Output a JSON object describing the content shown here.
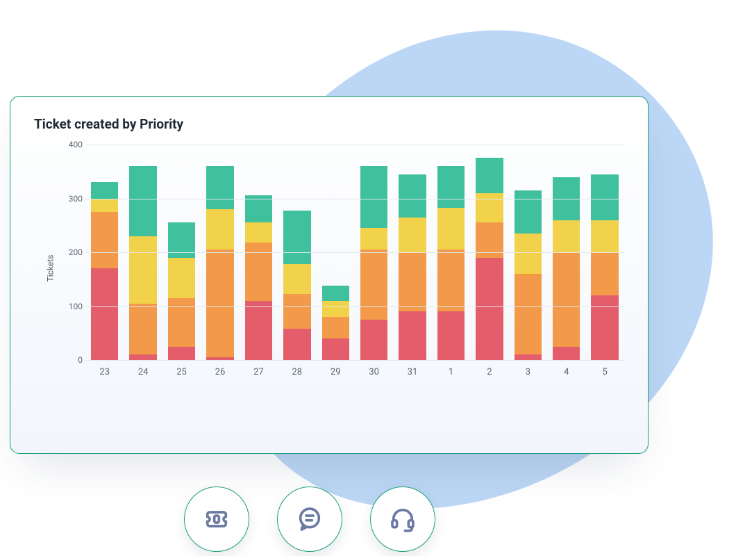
{
  "title": "Ticket created by Priority",
  "colors": {
    "red": "#e35d6a",
    "orange": "#f2994a",
    "yellow": "#f2d24a",
    "green": "#3fc19e",
    "card_border": "#1e9e7a",
    "blob": "#bcd6f5"
  },
  "chart_data": {
    "type": "bar",
    "stacked": true,
    "title": "Ticket created by Priority",
    "xlabel": "",
    "ylabel": "Tickets",
    "ylim": [
      0,
      400
    ],
    "yticks": [
      0,
      100,
      200,
      300,
      400
    ],
    "categories": [
      "23",
      "24",
      "25",
      "26",
      "27",
      "28",
      "29",
      "30",
      "31",
      "1",
      "2",
      "3",
      "4",
      "5"
    ],
    "series": [
      {
        "name": "red",
        "color": "#e35d6a",
        "values": [
          170,
          10,
          25,
          5,
          110,
          58,
          40,
          75,
          90,
          90,
          190,
          10,
          25,
          120
        ]
      },
      {
        "name": "orange",
        "color": "#f2994a",
        "values": [
          105,
          95,
          90,
          200,
          108,
          65,
          40,
          130,
          110,
          115,
          65,
          150,
          175,
          80
        ]
      },
      {
        "name": "yellow",
        "color": "#f2d24a",
        "values": [
          25,
          125,
          75,
          75,
          38,
          55,
          30,
          40,
          65,
          78,
          55,
          75,
          60,
          60
        ]
      },
      {
        "name": "green",
        "color": "#3fc19e",
        "values": [
          30,
          130,
          65,
          80,
          50,
          100,
          28,
          115,
          80,
          77,
          65,
          80,
          80,
          85
        ]
      }
    ]
  },
  "icons": [
    {
      "id": "ticket",
      "label": "Tickets"
    },
    {
      "id": "chat",
      "label": "Chat"
    },
    {
      "id": "headset",
      "label": "Support"
    }
  ]
}
